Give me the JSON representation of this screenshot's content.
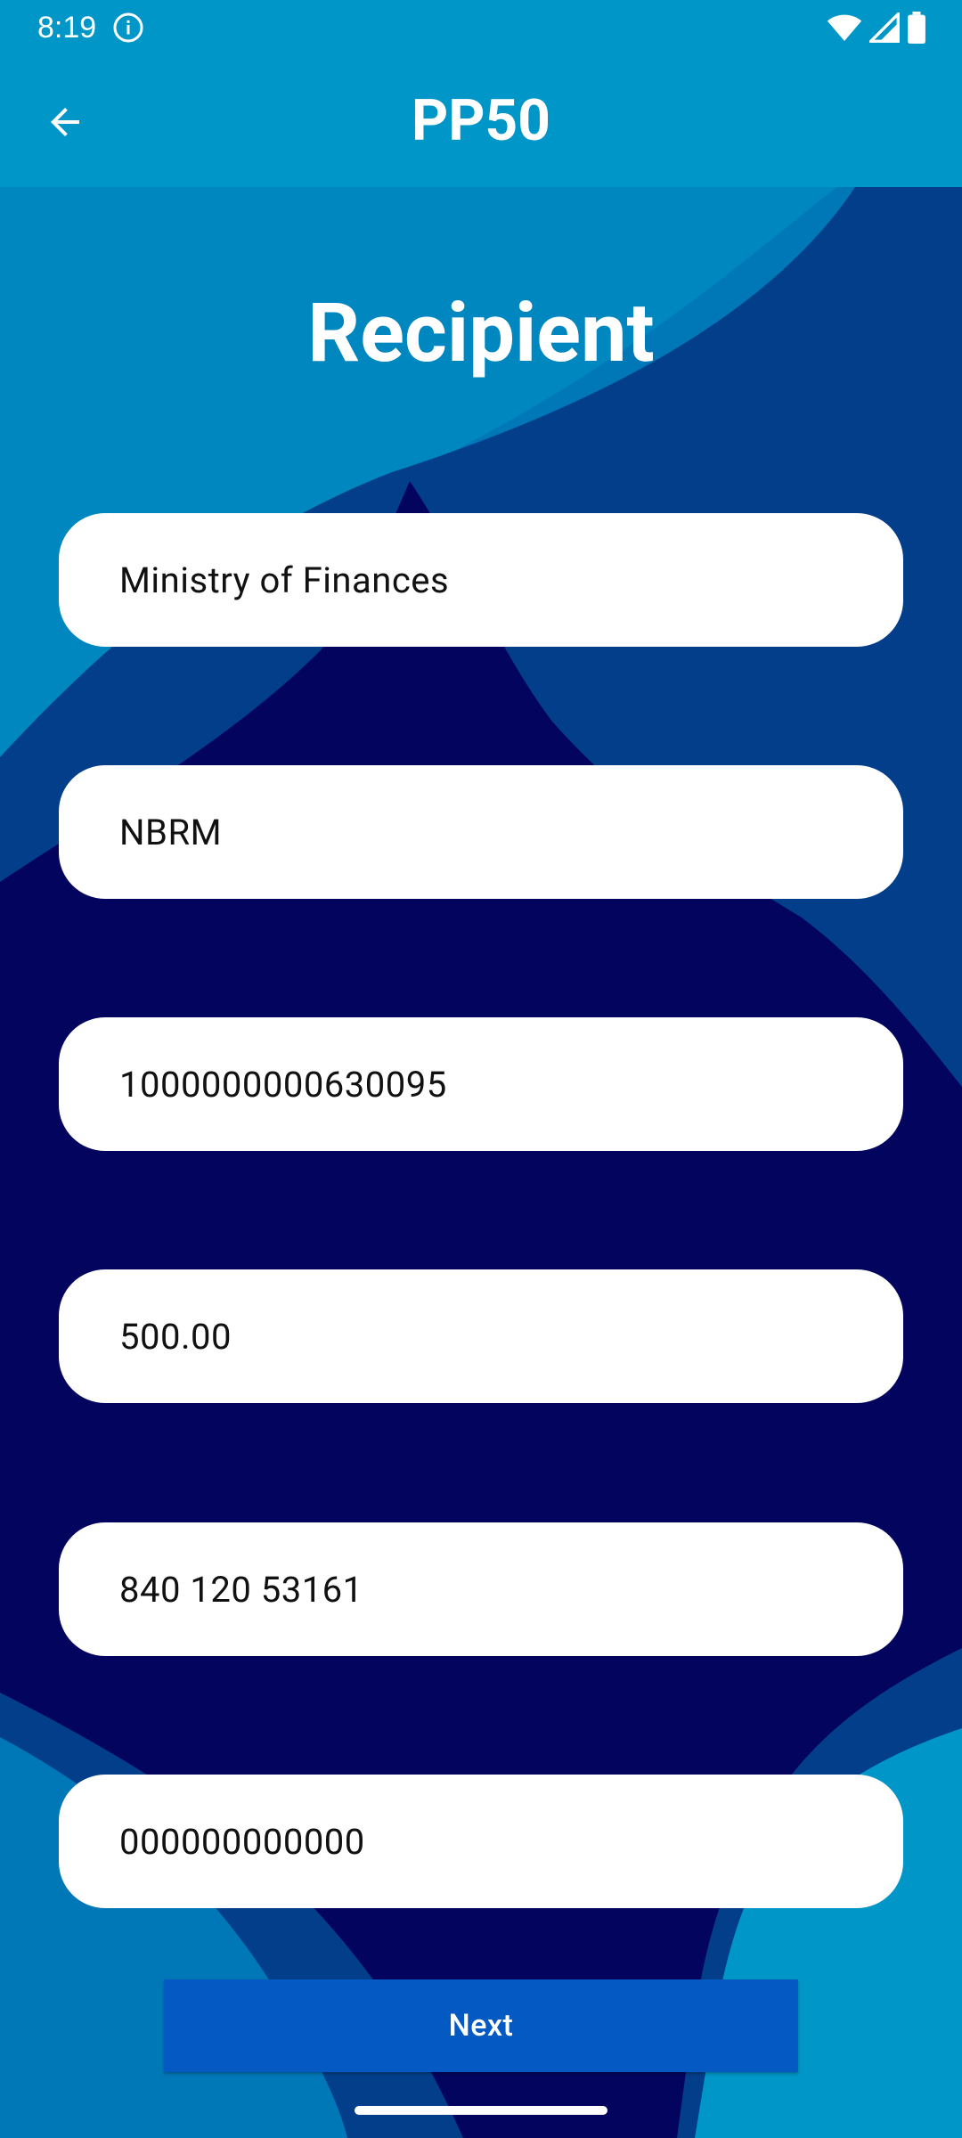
{
  "status_bar": {
    "time": "8:19",
    "icons": [
      "info-icon",
      "wifi-icon",
      "signal-icon",
      "battery-icon"
    ]
  },
  "app_bar": {
    "title": "PP50",
    "back_icon": "arrow-left-icon"
  },
  "page": {
    "heading": "Recipient"
  },
  "fields": [
    {
      "value": "Ministry of Finances"
    },
    {
      "value": "NBRM"
    },
    {
      "value": "1000000000630095"
    },
    {
      "value": "500.00"
    },
    {
      "value": "840 120 53161"
    },
    {
      "value": "000000000000"
    }
  ],
  "actions": {
    "next_label": "Next"
  },
  "colors": {
    "app_bar": "#0096C7",
    "background_light": "#0077B6",
    "background_mid": "#023E8A",
    "background_dark": "#03045E",
    "button": "#0559C2"
  }
}
